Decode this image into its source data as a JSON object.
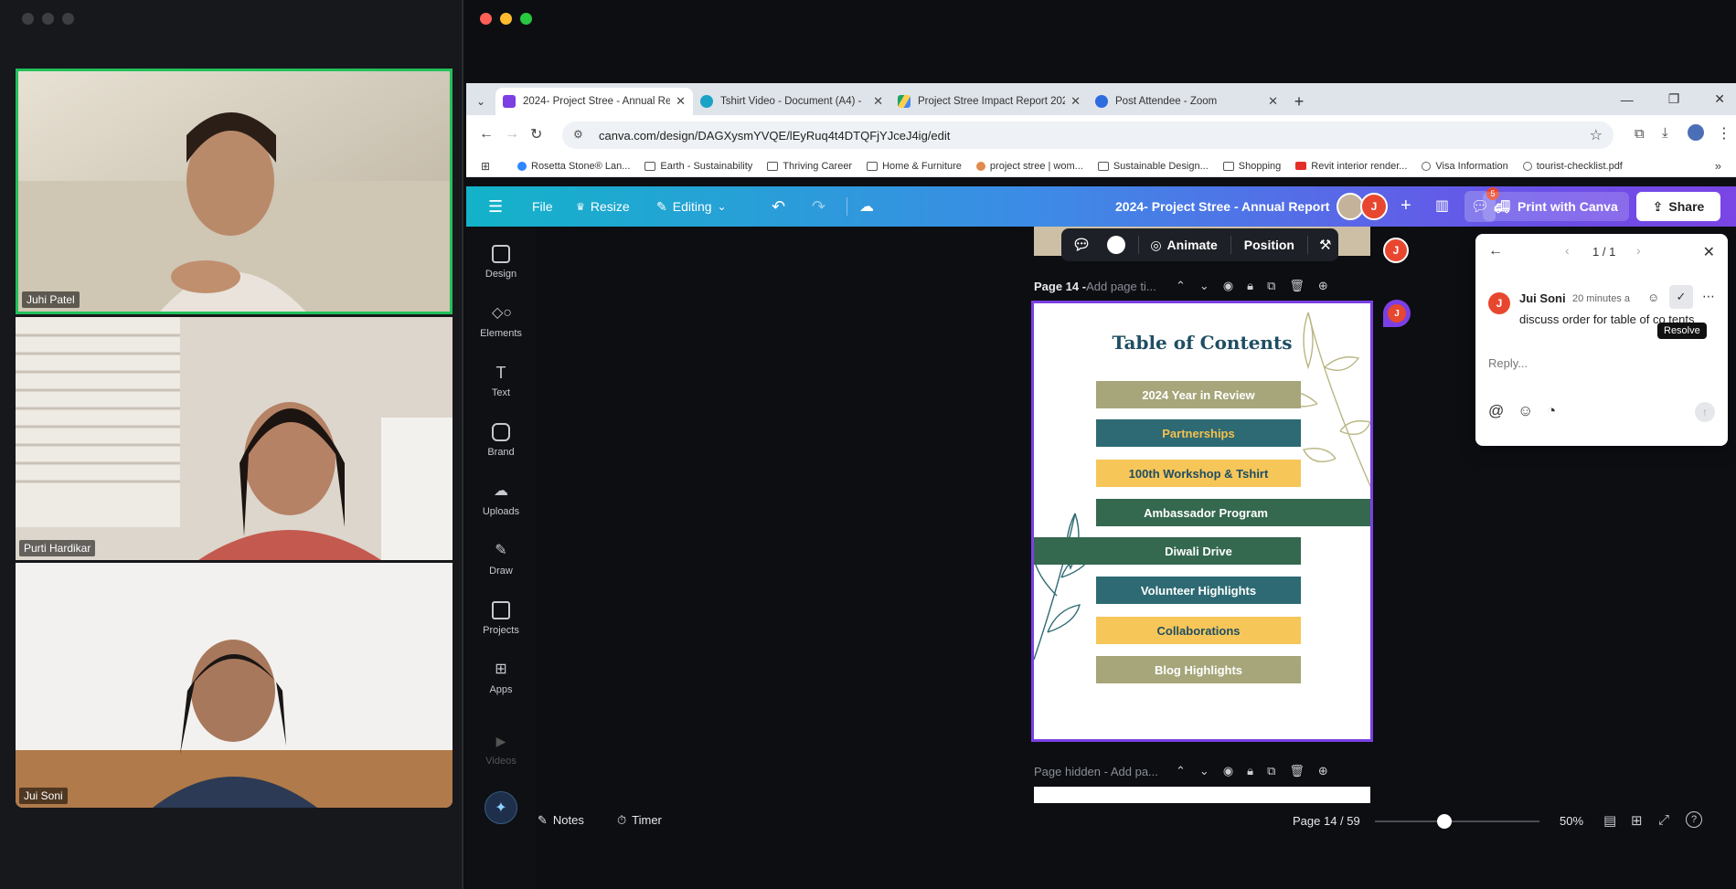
{
  "zoom": {
    "participants": [
      {
        "name": "Juhi Patel",
        "active": true
      },
      {
        "name": "Purti Hardikar",
        "active": false
      },
      {
        "name": "Jui Soni",
        "active": false
      }
    ]
  },
  "browser": {
    "tabs": [
      {
        "title": "2024- Project Stree - Annual Re",
        "favicon_color": "#7b3fe4",
        "active": true
      },
      {
        "title": "Tshirt Video - Document (A4) - ",
        "favicon_color": "#1aa3c7",
        "active": false
      },
      {
        "title": "Project Stree Impact Report 202",
        "favicon_color": "#f1b81a",
        "active": false
      },
      {
        "title": "Post Attendee - Zoom",
        "favicon_color": "#2d6cdf",
        "active": false
      }
    ],
    "url": "canva.com/design/DAGXysmYVQE/lEyRuq4t4DTQFjYJceJ4ig/edit",
    "bookmarks": [
      {
        "label": "Rosetta Stone® Lan..."
      },
      {
        "label": "Earth - Sustainability"
      },
      {
        "label": "Thriving Career"
      },
      {
        "label": "Home & Furniture"
      },
      {
        "label": "project stree | wom..."
      },
      {
        "label": "Sustainable Design..."
      },
      {
        "label": "Shopping"
      },
      {
        "label": "Revit interior render..."
      },
      {
        "label": "Visa Information"
      },
      {
        "label": "tourist-checklist.pdf"
      }
    ]
  },
  "canva": {
    "header": {
      "file": "File",
      "resize": "Resize",
      "editing": "Editing",
      "doc_title": "2024- Project Stree - Annual Report",
      "avatar_letter": "J",
      "comment_count": "5",
      "print": "Print with Canva",
      "share": "Share"
    },
    "rail": [
      {
        "label": "Design"
      },
      {
        "label": "Elements"
      },
      {
        "label": "Text"
      },
      {
        "label": "Brand"
      },
      {
        "label": "Uploads"
      },
      {
        "label": "Draw"
      },
      {
        "label": "Projects"
      },
      {
        "label": "Apps"
      },
      {
        "label": "Videos"
      }
    ],
    "float_toolbar": {
      "animate": "Animate",
      "position": "Position"
    },
    "page": {
      "label_bold": "Page 14 -",
      "label_placeholder": " Add page ti...",
      "title": "Table of Contents",
      "items": [
        {
          "label": "2024 Year in Review",
          "bg": "#a6a67a",
          "fg": "#ffffff"
        },
        {
          "label": "Partnerships",
          "bg": "#2d6a73",
          "fg": "#f4c04e"
        },
        {
          "label": "100th Workshop & Tshirt",
          "bg": "#f6c659",
          "fg": "#1e4e63"
        },
        {
          "label": "Ambassador Program",
          "bg": "#34684f",
          "fg": "#ffffff"
        },
        {
          "label": "Diwali Drive",
          "bg": "#34684f",
          "fg": "#ffffff"
        },
        {
          "label": "Volunteer Highlights",
          "bg": "#2d6a73",
          "fg": "#ffffff"
        },
        {
          "label": "Collaborations",
          "bg": "#f6c659",
          "fg": "#1e4e63"
        },
        {
          "label": "Blog Highlights",
          "bg": "#a6a67a",
          "fg": "#ffffff"
        }
      ]
    },
    "next_page": {
      "label": "Page hidden - Add pa..."
    },
    "bottom": {
      "notes": "Notes",
      "timer": "Timer",
      "page_indicator": "Page 14 / 59",
      "zoom_level": "50%",
      "zoom_fraction": 0.42
    },
    "comments": {
      "counter": "1 / 1",
      "author": "Jui Soni",
      "time": "20 minutes a",
      "text": "discuss order for table of co  tents",
      "reply_placeholder": "Reply...",
      "tooltip": "Resolve"
    }
  }
}
